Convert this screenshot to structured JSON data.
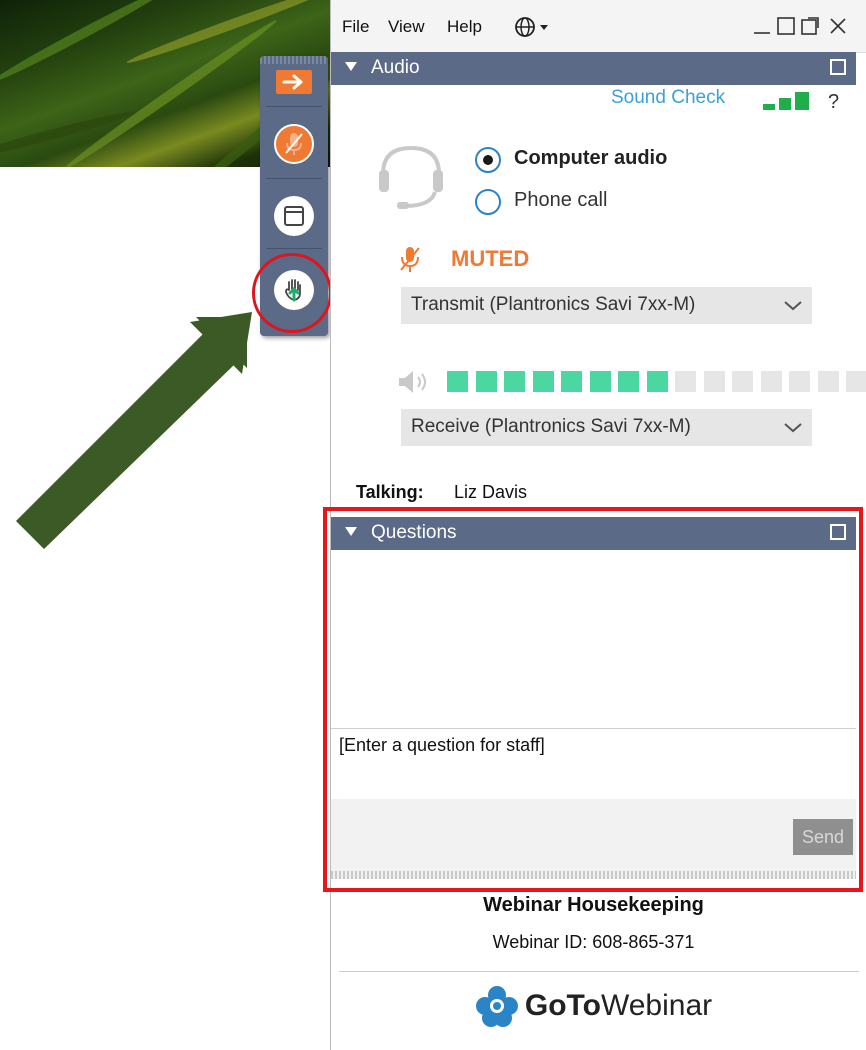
{
  "menubar": {
    "file": "File",
    "view": "View",
    "help": "Help"
  },
  "audio": {
    "header": "Audio",
    "sound_check": "Sound Check",
    "help_mark": "?",
    "options": [
      "Computer audio",
      "Phone call"
    ],
    "selected_option": "Computer audio",
    "muted_label": "MUTED",
    "transmit_device": "Transmit (Plantronics Savi 7xx-M)",
    "receive_device": "Receive (Plantronics Savi 7xx-M)",
    "speaker_level": 0.55,
    "talking_label": "Talking:",
    "talking_name": "Liz Davis"
  },
  "questions": {
    "header": "Questions",
    "input_value": "[Enter a question for staff]",
    "send_label": "Send"
  },
  "footer": {
    "title": "Webinar Housekeeping",
    "webinar_id": "Webinar ID: 608-865-371",
    "logo_goto": "GoTo",
    "logo_webinar": "Webinar"
  },
  "colors": {
    "accent_blue": "#2b84c6",
    "header_bar": "#5b6a86",
    "muted_orange": "#f07a33",
    "level_green": "#4bd6a2",
    "highlight_red": "#e8151b",
    "arrow_green": "#3b5a26"
  },
  "icons": [
    "arrow-right-icon",
    "mic-muted-icon",
    "window-icon",
    "raise-hand-icon",
    "globe-icon",
    "headset-icon",
    "speaker-icon",
    "gotowebinar-logo-icon"
  ]
}
